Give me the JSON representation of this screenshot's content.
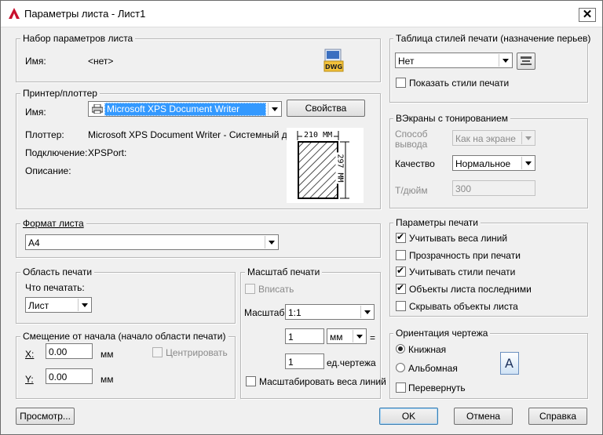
{
  "window": {
    "title": "Параметры листа - Лист1",
    "close_glyph": "✕"
  },
  "page_setup": {
    "legend": "Набор параметров листа",
    "name_label": "Имя:",
    "name_value": "<нет>",
    "dwg_icon_text": "DWG"
  },
  "printer": {
    "legend": "Принтер/плоттер",
    "name_label": "Имя:",
    "name_value": "Microsoft XPS Document Writer",
    "properties_button": "Свойства",
    "plotter_label": "Плоттер:",
    "plotter_value": "Microsoft XPS Document Writer - Системный дра...",
    "connection_label": "Подключение:",
    "connection_value": "XPSPort:",
    "description_label": "Описание:",
    "preview_width_label": "210 ММ",
    "preview_height_label": "297 ММ"
  },
  "paper_size": {
    "legend": "Формат листа",
    "value": "A4"
  },
  "plot_area": {
    "legend": "Область печати",
    "what_label": "Что печатать:",
    "value": "Лист"
  },
  "plot_offset": {
    "legend": "Смещение от начала (начало области печати)",
    "x_label": "X:",
    "x_value": "0.00",
    "x_unit": "мм",
    "y_label": "Y:",
    "y_value": "0.00",
    "y_unit": "мм",
    "center_label": "Центрировать"
  },
  "plot_scale": {
    "legend": "Масштаб печати",
    "fit_label": "Вписать",
    "scale_label": "Масштаб:",
    "scale_value": "1:1",
    "value1": "1",
    "unit_value": "мм",
    "equals": "=",
    "value2": "1",
    "drawing_units_label": "ед.чертежа",
    "scale_lineweights_label": "Масштабировать веса линий"
  },
  "plot_style": {
    "legend": "Таблица стилей печати (назначение перьев)",
    "value": "Нет",
    "display_label": "Показать стили печати"
  },
  "shaded": {
    "legend": "ВЭкраны с тонированием",
    "output_label": "Способ вывода",
    "output_value": "Как на экране",
    "quality_label": "Качество",
    "quality_value": "Нормальное",
    "dpi_label": "Т/дюйм",
    "dpi_value": "300"
  },
  "plot_options": {
    "legend": "Параметры печати",
    "items": [
      {
        "label": "Учитывать веса линий",
        "checked": true
      },
      {
        "label": "Прозрачность при печати",
        "checked": false
      },
      {
        "label": "Учитывать стили печати",
        "checked": true
      },
      {
        "label": "Объекты листа последними",
        "checked": true
      },
      {
        "label": "Скрывать объекты листа",
        "checked": false
      }
    ]
  },
  "orientation": {
    "legend": "Ориентация чертежа",
    "portrait_label": "Книжная",
    "landscape_label": "Альбомная",
    "upside_down_label": "Перевернуть",
    "icon_letter": "A"
  },
  "buttons": {
    "preview": "Просмотр...",
    "ok": "OK",
    "cancel": "Отмена",
    "help": "Справка"
  },
  "colors": {
    "selection": "#3399ff",
    "autocad_red": "#c8102e"
  }
}
